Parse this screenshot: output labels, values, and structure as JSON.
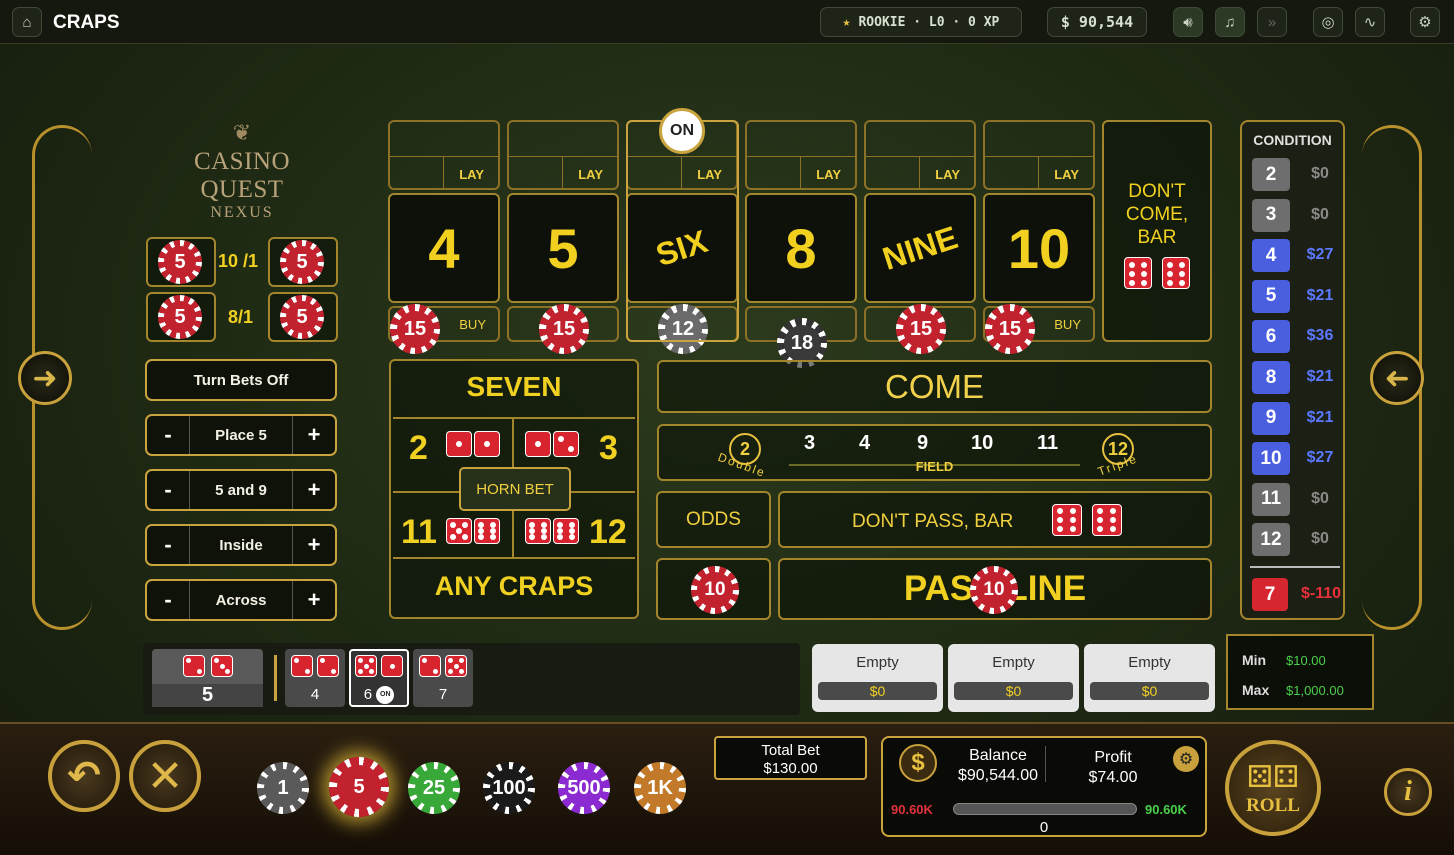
{
  "topbar": {
    "title": "CRAPS",
    "level_badge": "ROOKIE · L0 · 0 XP",
    "balance": "$ 90,544",
    "icons": [
      "home-icon",
      "speaker-icon",
      "music-icon",
      "fast-forward-icon",
      "target-icon",
      "pulse-icon",
      "settings-icon"
    ]
  },
  "logo": {
    "line1": "CASINO QUEST",
    "line2": "NEXUS"
  },
  "hardways": {
    "payout_top": "10 /1",
    "payout_bottom": "8/1",
    "chips": [
      "5",
      "5",
      "5",
      "5"
    ]
  },
  "left_controls": {
    "turn_bets_off": "Turn Bets Off",
    "presets": [
      {
        "label": "Place 5",
        "minus": "-",
        "plus": "+"
      },
      {
        "label": "5 and 9",
        "minus": "-",
        "plus": "+"
      },
      {
        "label": "Inside",
        "minus": "-",
        "plus": "+"
      },
      {
        "label": "Across",
        "minus": "-",
        "plus": "+"
      }
    ]
  },
  "puck": "ON",
  "place_numbers": [
    {
      "label": "4",
      "lay": "LAY",
      "buy": "BUY",
      "chip": "15",
      "chip_color": "red"
    },
    {
      "label": "5",
      "lay": "LAY",
      "buy": "",
      "chip": "15",
      "chip_color": "red"
    },
    {
      "label": "SIX",
      "lay": "LAY",
      "buy": "",
      "chip": "12",
      "chip_color": "gray"
    },
    {
      "label": "8",
      "lay": "LAY",
      "buy": "",
      "chip": "18",
      "chip_color": "gray"
    },
    {
      "label": "NINE",
      "lay": "LAY",
      "buy": "",
      "chip": "15",
      "chip_color": "red"
    },
    {
      "label": "10",
      "lay": "LAY",
      "buy": "BUY",
      "chip": "15",
      "chip_color": "red"
    }
  ],
  "dont_come": "DON'T COME, BAR",
  "proposition": {
    "seven": "SEVEN",
    "left_top": "2",
    "right_top": "3",
    "horn": "HORN BET",
    "left_bottom": "11",
    "right_bottom": "12",
    "any_craps": "ANY CRAPS"
  },
  "come": "COME",
  "field": {
    "numbers": [
      "3",
      "4",
      "9",
      "10",
      "11"
    ],
    "double_num": "2",
    "double_label": "Double",
    "triple_num": "12",
    "triple_label": "Triple",
    "label": "FIELD"
  },
  "odds": "ODDS",
  "odds_chip": "10",
  "dont_pass": "DON'T PASS, BAR",
  "pass_line": "PASS LINE",
  "pass_chip": "10",
  "condition": {
    "title": "CONDITION",
    "rows": [
      {
        "num": "2",
        "val": "$0",
        "color": "#6e6e6e",
        "vcolor": "#8a8a8a"
      },
      {
        "num": "3",
        "val": "$0",
        "color": "#6e6e6e",
        "vcolor": "#8a8a8a"
      },
      {
        "num": "4",
        "val": "$27",
        "color": "#4a5fe0",
        "vcolor": "#5b78ff"
      },
      {
        "num": "5",
        "val": "$21",
        "color": "#4a5fe0",
        "vcolor": "#5b78ff"
      },
      {
        "num": "6",
        "val": "$36",
        "color": "#4a5fe0",
        "vcolor": "#5b78ff"
      },
      {
        "num": "8",
        "val": "$21",
        "color": "#4a5fe0",
        "vcolor": "#5b78ff"
      },
      {
        "num": "9",
        "val": "$21",
        "color": "#4a5fe0",
        "vcolor": "#5b78ff"
      },
      {
        "num": "10",
        "val": "$27",
        "color": "#4a5fe0",
        "vcolor": "#5b78ff"
      },
      {
        "num": "11",
        "val": "$0",
        "color": "#6e6e6e",
        "vcolor": "#8a8a8a"
      },
      {
        "num": "12",
        "val": "$0",
        "color": "#6e6e6e",
        "vcolor": "#8a8a8a"
      }
    ],
    "seven": {
      "num": "7",
      "val": "$-110",
      "color": "#d6262f",
      "vcolor": "#e8303a"
    }
  },
  "history": {
    "current": "5",
    "rolls": [
      {
        "total": "4",
        "on": ""
      },
      {
        "total": "6",
        "on": "ON"
      },
      {
        "total": "7",
        "on": ""
      }
    ]
  },
  "slots": [
    {
      "title": "Empty",
      "value": "$0"
    },
    {
      "title": "Empty",
      "value": "$0"
    },
    {
      "title": "Empty",
      "value": "$0"
    }
  ],
  "limits": {
    "min_label": "Min",
    "min": "$10.00",
    "max_label": "Max",
    "max": "$1,000.00"
  },
  "bottom": {
    "chips": [
      {
        "label": "1",
        "color": "#5a5a5a"
      },
      {
        "label": "5",
        "color": "#c2222e"
      },
      {
        "label": "25",
        "color": "#38a838"
      },
      {
        "label": "100",
        "color": "#1a1a1a"
      },
      {
        "label": "500",
        "color": "#8a2ad0"
      },
      {
        "label": "1K",
        "color": "#c27a2a"
      }
    ],
    "total_bet_label": "Total Bet",
    "total_bet": "$130.00",
    "balance_label": "Balance",
    "balance": "$90,544.00",
    "profit_label": "Profit",
    "profit": "$74.00",
    "range_left": "90.60K",
    "range_right": "90.60K",
    "range_value": "0",
    "roll": "ROLL"
  }
}
